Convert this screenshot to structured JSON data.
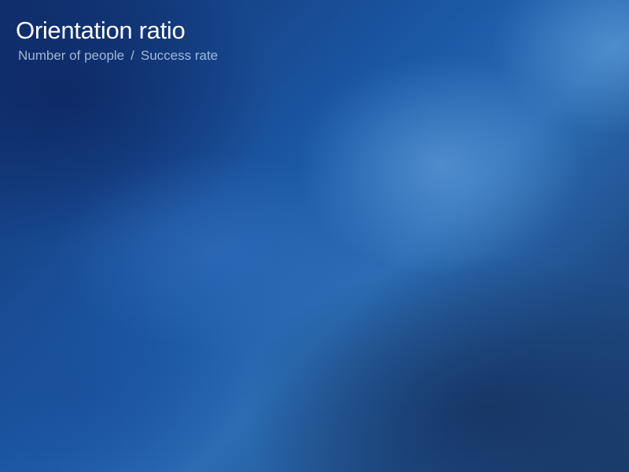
{
  "slide": {
    "title": "Orientation ratio",
    "subtitle_left": "Number of people",
    "subtitle_separator": "/",
    "subtitle_right": "Success rate"
  },
  "colors": {
    "background_dark": "#0e2f6e",
    "background_mid": "#1a5aa8",
    "background_light": "#2a6db5",
    "title_text": "#ffffff",
    "subtitle_text": "#c8dcf5"
  }
}
